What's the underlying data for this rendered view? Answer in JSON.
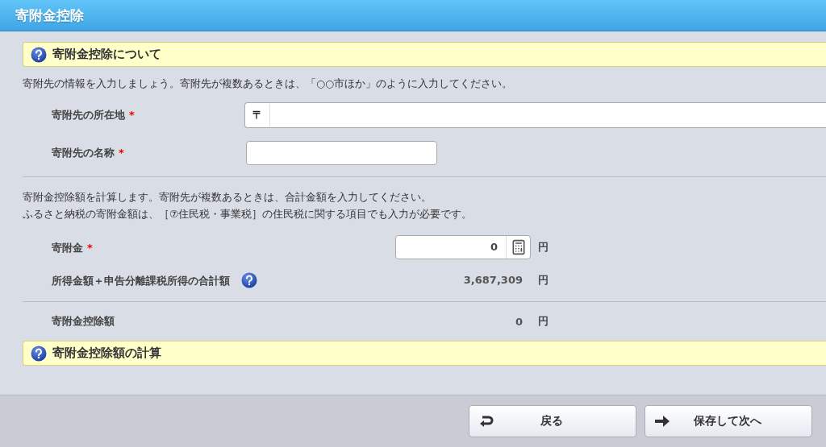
{
  "window": {
    "title": "寄附金控除"
  },
  "info_panel": {
    "title": "寄附金控除について"
  },
  "intro": "寄附先の情報を入力しましょう。寄附先が複数あるときは、「○○市ほか」のように入力してください。",
  "donee_fields": [
    {
      "kind": "postal",
      "label": "寄附先の所在地",
      "required": "*",
      "prefix": "〒"
    },
    {
      "kind": "plain",
      "label": "寄附先の名称",
      "required": "*"
    }
  ],
  "calc_note": [
    "寄附金控除額を計算します。寄附先が複数あるときは、合計金額を入力してください。",
    "ふるさと納税の寄附金額は、［⑦住民税・事業税］の住民税に関する項目でも入力が必要です。"
  ],
  "amount_rows": [
    {
      "kind": "input",
      "label": "寄附金",
      "required": "*",
      "value": "0",
      "unit": "円"
    },
    {
      "kind": "display",
      "label": "所得金額＋申告分離課税所得の合計額",
      "help": true,
      "value": "3,687,309",
      "unit": "円"
    }
  ],
  "result_row": {
    "label": "寄附金控除額",
    "value": "0",
    "unit": "円"
  },
  "calc_panel": {
    "title": "寄附金控除額の計算"
  },
  "buttons": [
    {
      "kind": "back",
      "label": "戻る"
    },
    {
      "kind": "next",
      "label": "保存して次へ"
    }
  ]
}
